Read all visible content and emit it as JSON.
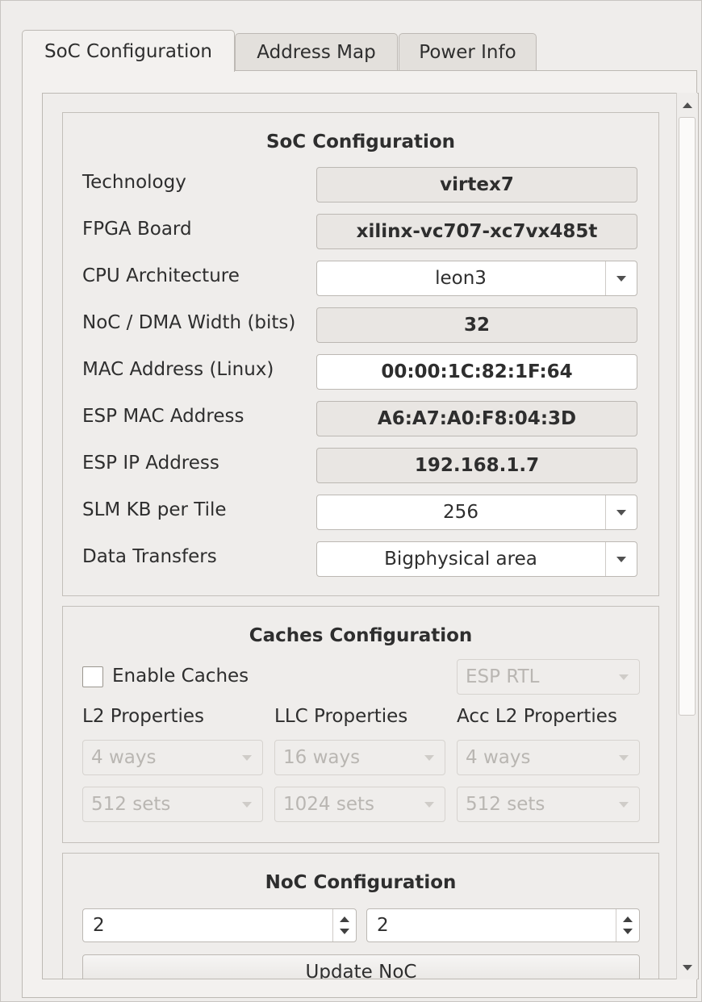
{
  "tabs": [
    {
      "label": "SoC Configuration",
      "active": true
    },
    {
      "label": "Address Map",
      "active": false
    },
    {
      "label": "Power Info",
      "active": false
    }
  ],
  "soc": {
    "title": "SoC Configuration",
    "technology": {
      "label": "Technology",
      "value": "virtex7"
    },
    "fpga_board": {
      "label": "FPGA Board",
      "value": "xilinx-vc707-xc7vx485t"
    },
    "cpu_arch": {
      "label": "CPU Architecture",
      "value": "leon3"
    },
    "noc_width": {
      "label": "NoC / DMA Width (bits)",
      "value": "32"
    },
    "mac_linux": {
      "label": "MAC Address (Linux)",
      "value": "00:00:1C:82:1F:64"
    },
    "esp_mac": {
      "label": "ESP MAC Address",
      "value": "A6:A7:A0:F8:04:3D"
    },
    "esp_ip": {
      "label": "ESP IP Address",
      "value": "192.168.1.7"
    },
    "slm_kb": {
      "label": "SLM KB per Tile",
      "value": "256"
    },
    "data_transfers": {
      "label": "Data Transfers",
      "value": "Bigphysical area"
    }
  },
  "caches": {
    "title": "Caches Configuration",
    "enable_label": "Enable Caches",
    "enabled": false,
    "rtl": "ESP RTL",
    "l2": {
      "label": "L2 Properties",
      "ways": "4 ways",
      "sets": "512 sets"
    },
    "llc": {
      "label": "LLC Properties",
      "ways": "16 ways",
      "sets": "1024 sets"
    },
    "acc_l2": {
      "label": "Acc L2 Properties",
      "ways": "4 ways",
      "sets": "512 sets"
    }
  },
  "noc": {
    "title": "NoC Configuration",
    "rows": "2",
    "cols": "2",
    "update_label": "Update NoC"
  }
}
